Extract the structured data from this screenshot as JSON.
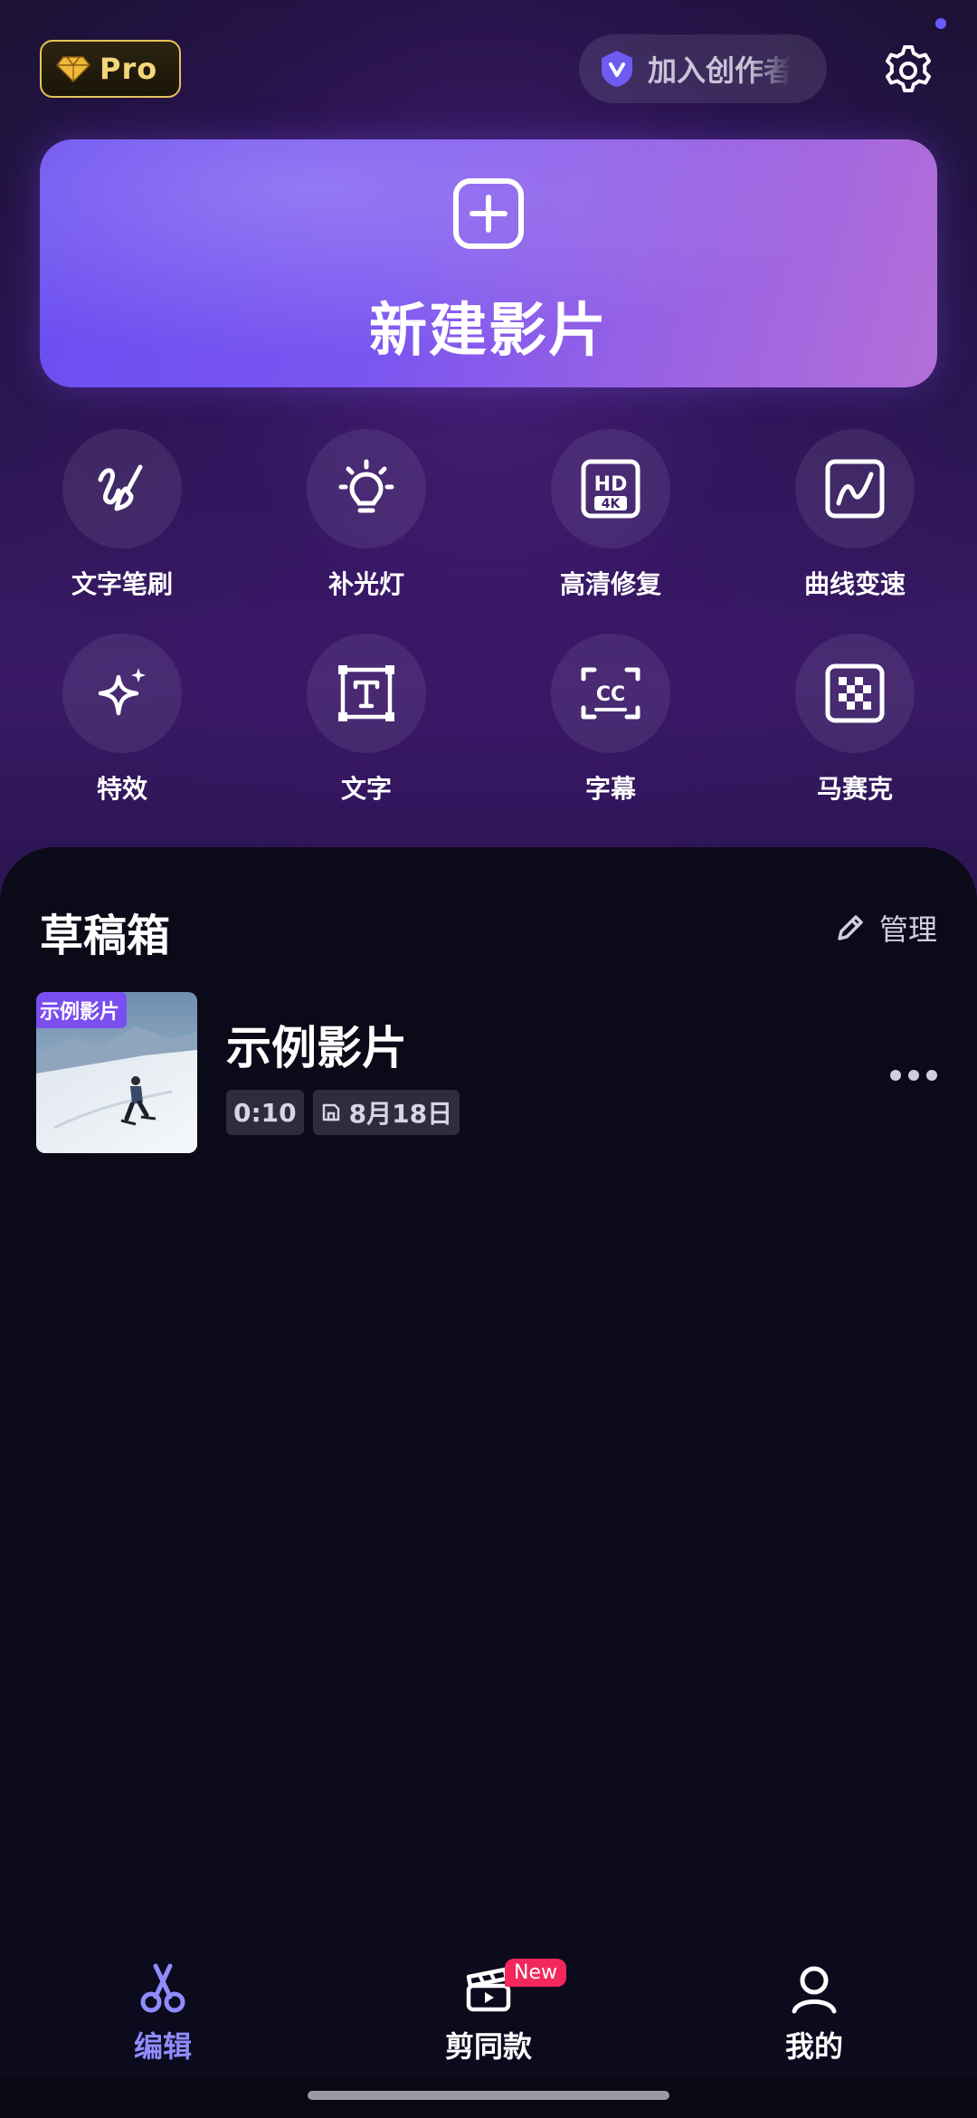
{
  "header": {
    "pro_label": "Pro",
    "creator_label": "加入创作者"
  },
  "hero": {
    "new_film_label": "新建影片"
  },
  "tools": [
    {
      "label": "文字笔刷",
      "icon": "brush-icon"
    },
    {
      "label": "补光灯",
      "icon": "bulb-icon"
    },
    {
      "label": "高清修复",
      "icon": "hd-4k-icon"
    },
    {
      "label": "曲线变速",
      "icon": "curve-speed-icon"
    },
    {
      "label": "特效",
      "icon": "sparkle-icon"
    },
    {
      "label": "文字",
      "icon": "text-frame-icon"
    },
    {
      "label": "字幕",
      "icon": "caption-cc-icon"
    },
    {
      "label": "马赛克",
      "icon": "mosaic-icon"
    }
  ],
  "drafts": {
    "title": "草稿箱",
    "manage_label": "管理",
    "items": [
      {
        "badge": "示例影片",
        "title": "示例影片",
        "duration": "0:10",
        "date": "8月18日"
      }
    ]
  },
  "tabs": [
    {
      "label": "编辑",
      "icon": "scissors-icon",
      "active": true,
      "color": "#8f8cff"
    },
    {
      "label": "剪同款",
      "icon": "template-video-icon",
      "badge": "New"
    },
    {
      "label": "我的",
      "icon": "user-icon"
    }
  ],
  "colors": {
    "accent": "#7b4ef0",
    "active_tab": "#8f8cff",
    "new_badge": "#f2275c",
    "pro_gold": "#e7c25a"
  }
}
